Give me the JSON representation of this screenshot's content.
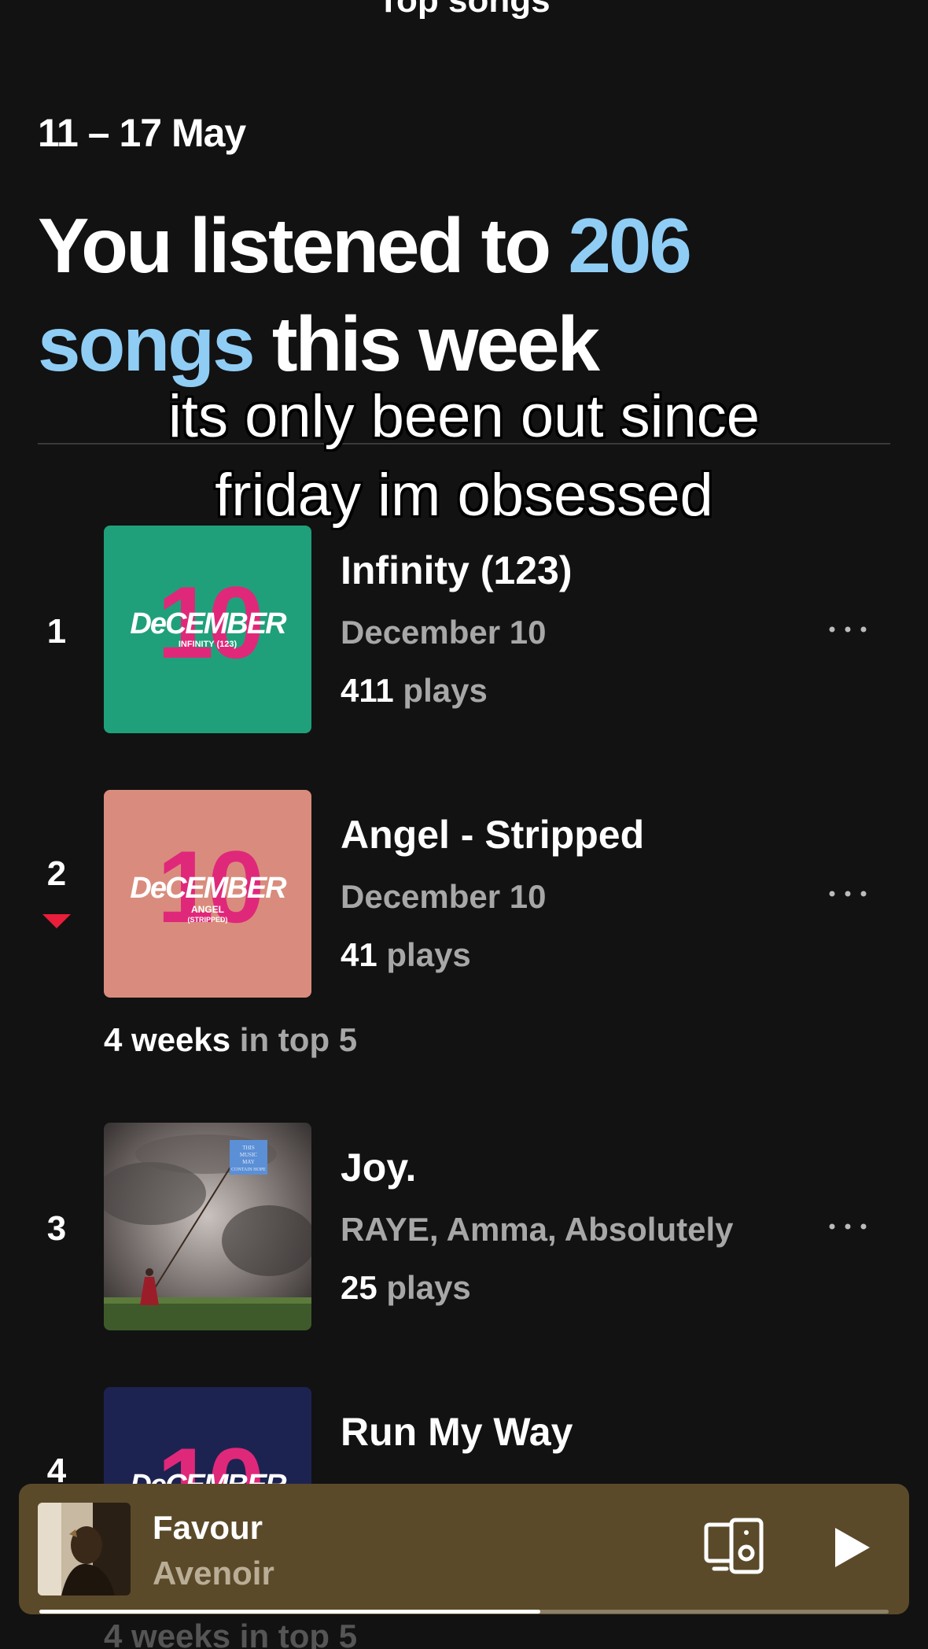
{
  "header": {
    "title": "Top songs"
  },
  "date_range": "11 – 17 May",
  "headline": {
    "part1": "You listened to ",
    "accent": "206 songs",
    "part2": " this week"
  },
  "caption": {
    "line1": "its only been out since",
    "line2": "friday im obsessed"
  },
  "colors": {
    "accent": "#8fcdf5",
    "background": "#121212",
    "player": "#5b4a29",
    "down_arrow": "#e91e3a"
  },
  "tracks": [
    {
      "rank": "1",
      "title": "Infinity (123)",
      "artist": "December 10",
      "plays": "411",
      "plays_label": " plays",
      "cover": {
        "bg": "#1fa07a",
        "word": "DeCEMBER",
        "sub": "INFINITY (123)",
        "num": "10"
      }
    },
    {
      "rank": "2",
      "title": "Angel - Stripped",
      "artist": "December 10",
      "plays": "41",
      "plays_label": " plays",
      "trend": "down",
      "cover": {
        "bg": "#d98c7d",
        "word": "DeCEMBER",
        "sub": "ANGEL",
        "sub2": "(STRIPPED)",
        "num": "10"
      },
      "weeks_bold": "4 weeks",
      "weeks_rest": " in top 5"
    },
    {
      "rank": "3",
      "title": "Joy.",
      "artist": "RAYE, Amma, Absolutely",
      "plays": "25",
      "plays_label": " plays",
      "cover": {
        "sign": "THIS MUSIC MAY CONTAIN HOPE"
      }
    },
    {
      "rank": "4",
      "title": "Run My Way",
      "cover": {
        "bg": "#1d2350",
        "word": "DeCEMBER",
        "num": "10"
      }
    }
  ],
  "bottom_note": "4 weeks in top 5",
  "mini_player": {
    "title": "Favour",
    "artist": "Avenoir",
    "progress": 0.59
  }
}
